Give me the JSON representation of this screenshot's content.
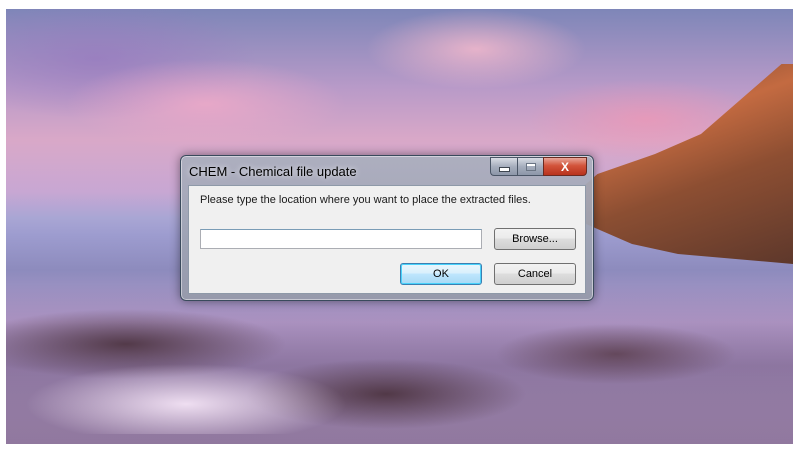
{
  "window": {
    "title": "CHEM - Chemical file update",
    "minimize_icon": "minimize-icon",
    "maximize_icon": "maximize-icon",
    "close_icon": "close-icon",
    "close_glyph": "X"
  },
  "dialog": {
    "prompt": "Please type the location where you want to place the extracted files.",
    "location_value": "",
    "browse_label": "Browse...",
    "ok_label": "OK",
    "cancel_label": "Cancel"
  },
  "colors": {
    "close_button": "#d2543b",
    "default_button_border": "#3c7fb1"
  }
}
